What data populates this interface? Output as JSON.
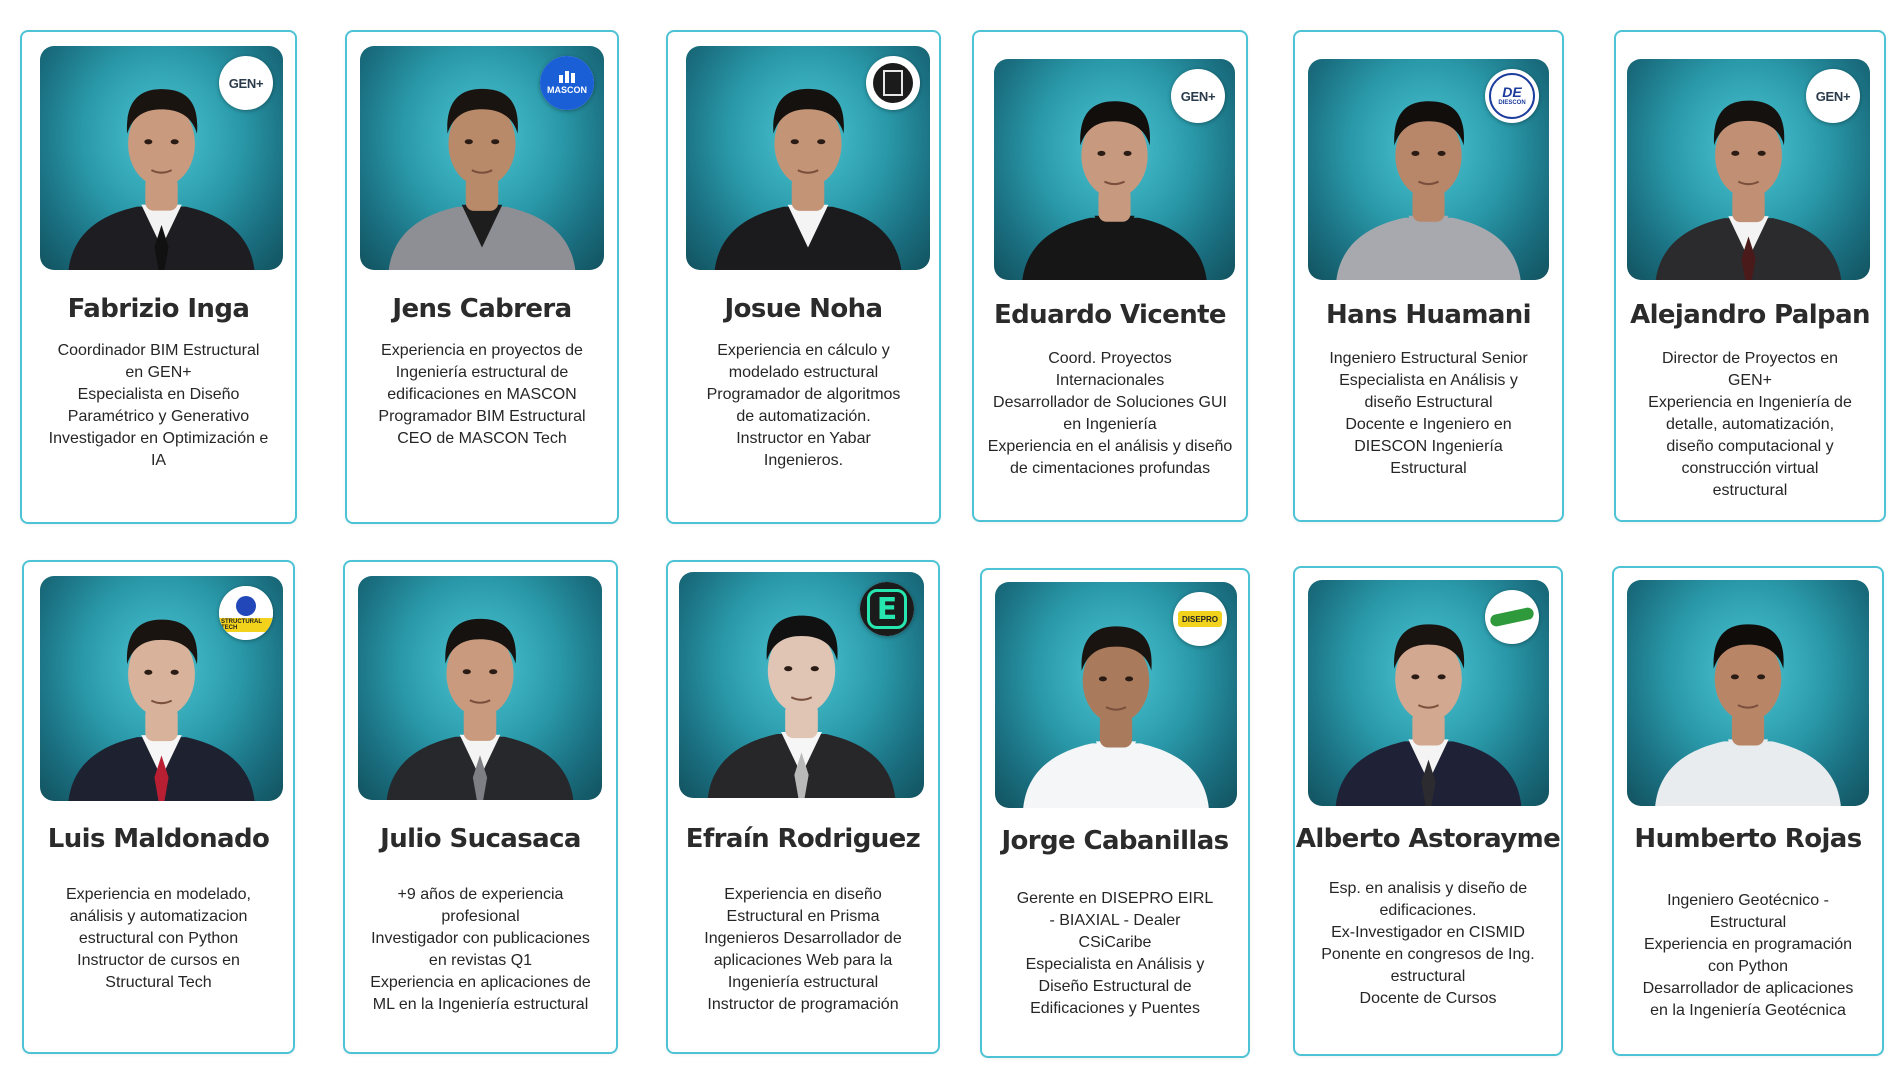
{
  "team": [
    {
      "name": "Fabrizio Inga",
      "badge": "GEN+",
      "badge_icon": "gen-plus-logo-icon",
      "lines": [
        "Coordinador  BIM Estructural",
        "en GEN+",
        "Especialista en Diseño",
        "Paramétrico y Generativo",
        "Investigador en Optimización e",
        "IA"
      ]
    },
    {
      "name": "Jens Cabrera",
      "badge": "MASCON",
      "badge_icon": "mascon-logo-icon",
      "lines": [
        "Experiencia en proyectos de",
        "Ingeniería estructural de",
        "edificaciones en MASCON",
        "Programador BIM Estructural",
        "CEO de MASCON Tech"
      ]
    },
    {
      "name": "Josue Noha",
      "badge": "",
      "badge_icon": "yabar-logo-icon",
      "lines": [
        "Experiencia en cálculo y",
        "modelado estructural",
        "Programador de algoritmos",
        "de automatización.",
        "Instructor en Yabar",
        "Ingenieros."
      ]
    },
    {
      "name": "Eduardo Vicente",
      "badge": "GEN+",
      "badge_icon": "gen-plus-logo-icon",
      "lines": [
        "Coord. Proyectos",
        "Internacionales",
        "Desarrollador de Soluciones GUI",
        "en Ingeniería",
        "Experiencia en el análisis y diseño",
        "de cimentaciones profundas"
      ]
    },
    {
      "name": "Hans Huamani",
      "badge": "DIESCON",
      "badge_icon": "diescon-logo-icon",
      "lines": [
        "Ingeniero Estructural Senior",
        "Especialista en Análisis y",
        "diseño Estructural",
        "Docente e Ingeniero en",
        "DIESCON Ingeniería",
        "Estructural"
      ]
    },
    {
      "name": "Alejandro Palpan",
      "badge": "GEN+",
      "badge_icon": "gen-plus-logo-icon",
      "lines": [
        "Director de Proyectos en",
        "GEN+",
        "Experiencia en Ingeniería de",
        "detalle, automatización,",
        "diseño computacional y",
        "construcción virtual",
        "estructural"
      ]
    },
    {
      "name": "Luis Maldonado",
      "badge": "STRUCTURAL TECH",
      "badge_icon": "structural-tech-logo-icon",
      "lines": [
        "Experiencia en modelado,",
        "análisis y automatizacion",
        "estructural con Python",
        "Instructor de cursos  en",
        "Structural Tech"
      ]
    },
    {
      "name": "Julio Sucasaca",
      "badge": "",
      "badge_icon": "",
      "lines": [
        "+9 años de experiencia",
        "profesional",
        "Investigador con publicaciones",
        "en revistas Q1",
        "Experiencia en aplicaciones de",
        "ML en la Ingeniería estructural"
      ]
    },
    {
      "name": "Efraín Rodriguez",
      "badge": "E",
      "badge_icon": "e-hexagon-logo-icon",
      "lines": [
        "Experiencia en diseño",
        "Estructural en Prisma",
        "Ingenieros Desarrollador de",
        "aplicaciones Web para la",
        "Ingeniería estructural",
        "Instructor de programación"
      ]
    },
    {
      "name": "Jorge Cabanillas",
      "badge": "DISEPRO",
      "badge_icon": "disepro-logo-icon",
      "lines": [
        "Gerente en DISEPRO EIRL",
        "- BIAXIAL - Dealer",
        "CSiCaribe",
        "Especialista en Análisis y",
        "Diseño Estructural de",
        "Edificaciones y Puentes"
      ]
    },
    {
      "name": "Alberto Astorayme",
      "badge": "",
      "badge_icon": "green-script-logo-icon",
      "lines": [
        "Esp. en analisis y diseño de",
        "edificaciones.",
        "Ex-Investigador en CISMID",
        "Ponente en congresos de Ing.",
        "estructural",
        "Docente de Cursos"
      ]
    },
    {
      "name": "Humberto Rojas",
      "badge": "",
      "badge_icon": "",
      "lines": [
        "Ingeniero Geotécnico -",
        "Estructural",
        "Experiencia en programación",
        "con Python",
        "Desarrollador de aplicaciones",
        "en la Ingeniería Geotécnica"
      ]
    }
  ],
  "colors": {
    "card_border": "#4fc3d6",
    "photo_bg_center": "#4dc5d2",
    "photo_bg_edge": "#12525f",
    "name_text": "#2b2b2b",
    "desc_text": "#262626"
  }
}
